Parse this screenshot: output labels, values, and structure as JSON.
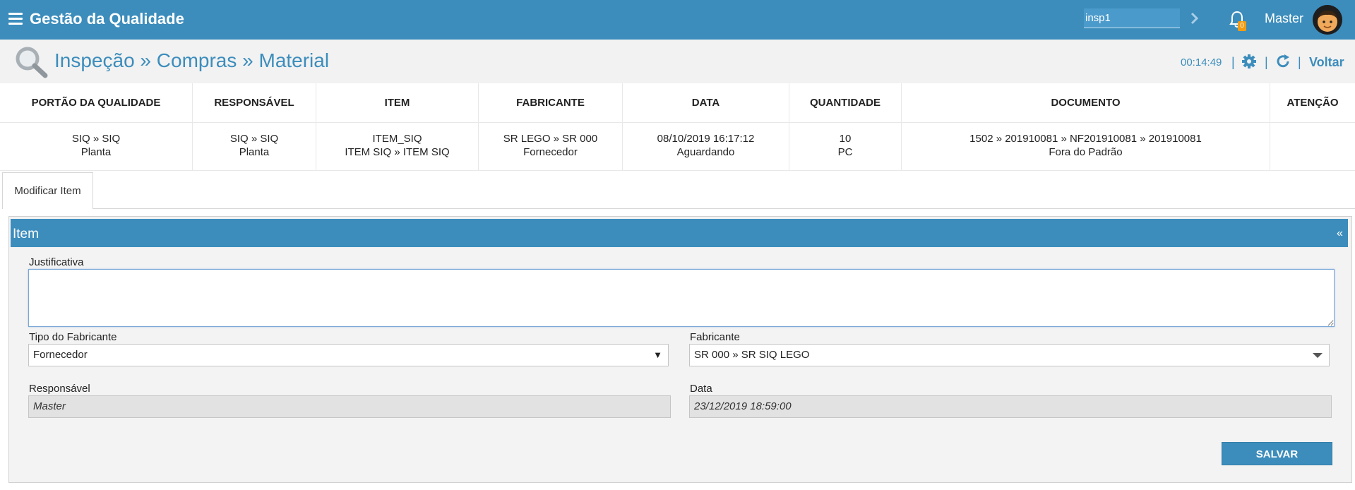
{
  "topbar": {
    "app_title": "Gestão da Qualidade",
    "search_value": "insp1",
    "notification_count": "0",
    "user_name": "Master",
    "color": "#3c8dbc"
  },
  "header": {
    "breadcrumb": "Inspeção » Compras » Material",
    "timer": "00:14:49",
    "back_label": "Voltar"
  },
  "summary": {
    "columns": [
      {
        "header": "PORTÃO DA QUALIDADE",
        "line1": "SIQ » SIQ",
        "line2": "Planta"
      },
      {
        "header": "RESPONSÁVEL",
        "line1": "SIQ » SIQ",
        "line2": "Planta"
      },
      {
        "header": "ITEM",
        "line1": "ITEM_SIQ",
        "line2": "ITEM SIQ » ITEM SIQ"
      },
      {
        "header": "FABRICANTE",
        "line1": "SR LEGO » SR 000",
        "line2": "Fornecedor"
      },
      {
        "header": "DATA",
        "line1": "08/10/2019 16:17:12",
        "line2": "Aguardando"
      },
      {
        "header": "QUANTIDADE",
        "line1": "10",
        "line2": "PC"
      },
      {
        "header": "DOCUMENTO",
        "line1": "1502 » 201910081 » NF201910081 » 201910081",
        "line2": "Fora do Padrão"
      },
      {
        "header": "ATENÇÃO",
        "line1": "",
        "line2": ""
      }
    ]
  },
  "tabs": [
    {
      "label": "Modificar Item"
    }
  ],
  "panel": {
    "title": "Item",
    "collapse_symbol": "«",
    "justificativa_label": "Justificativa",
    "justificativa_value": "",
    "tipo_fabricante_label": "Tipo do Fabricante",
    "tipo_fabricante_value": "Fornecedor",
    "fabricante_label": "Fabricante",
    "fabricante_value": "SR 000 » SR SIQ LEGO",
    "responsavel_label": "Responsável",
    "responsavel_value": "Master",
    "data_label": "Data",
    "data_value": "23/12/2019 18:59:00",
    "save_label": "SALVAR"
  }
}
